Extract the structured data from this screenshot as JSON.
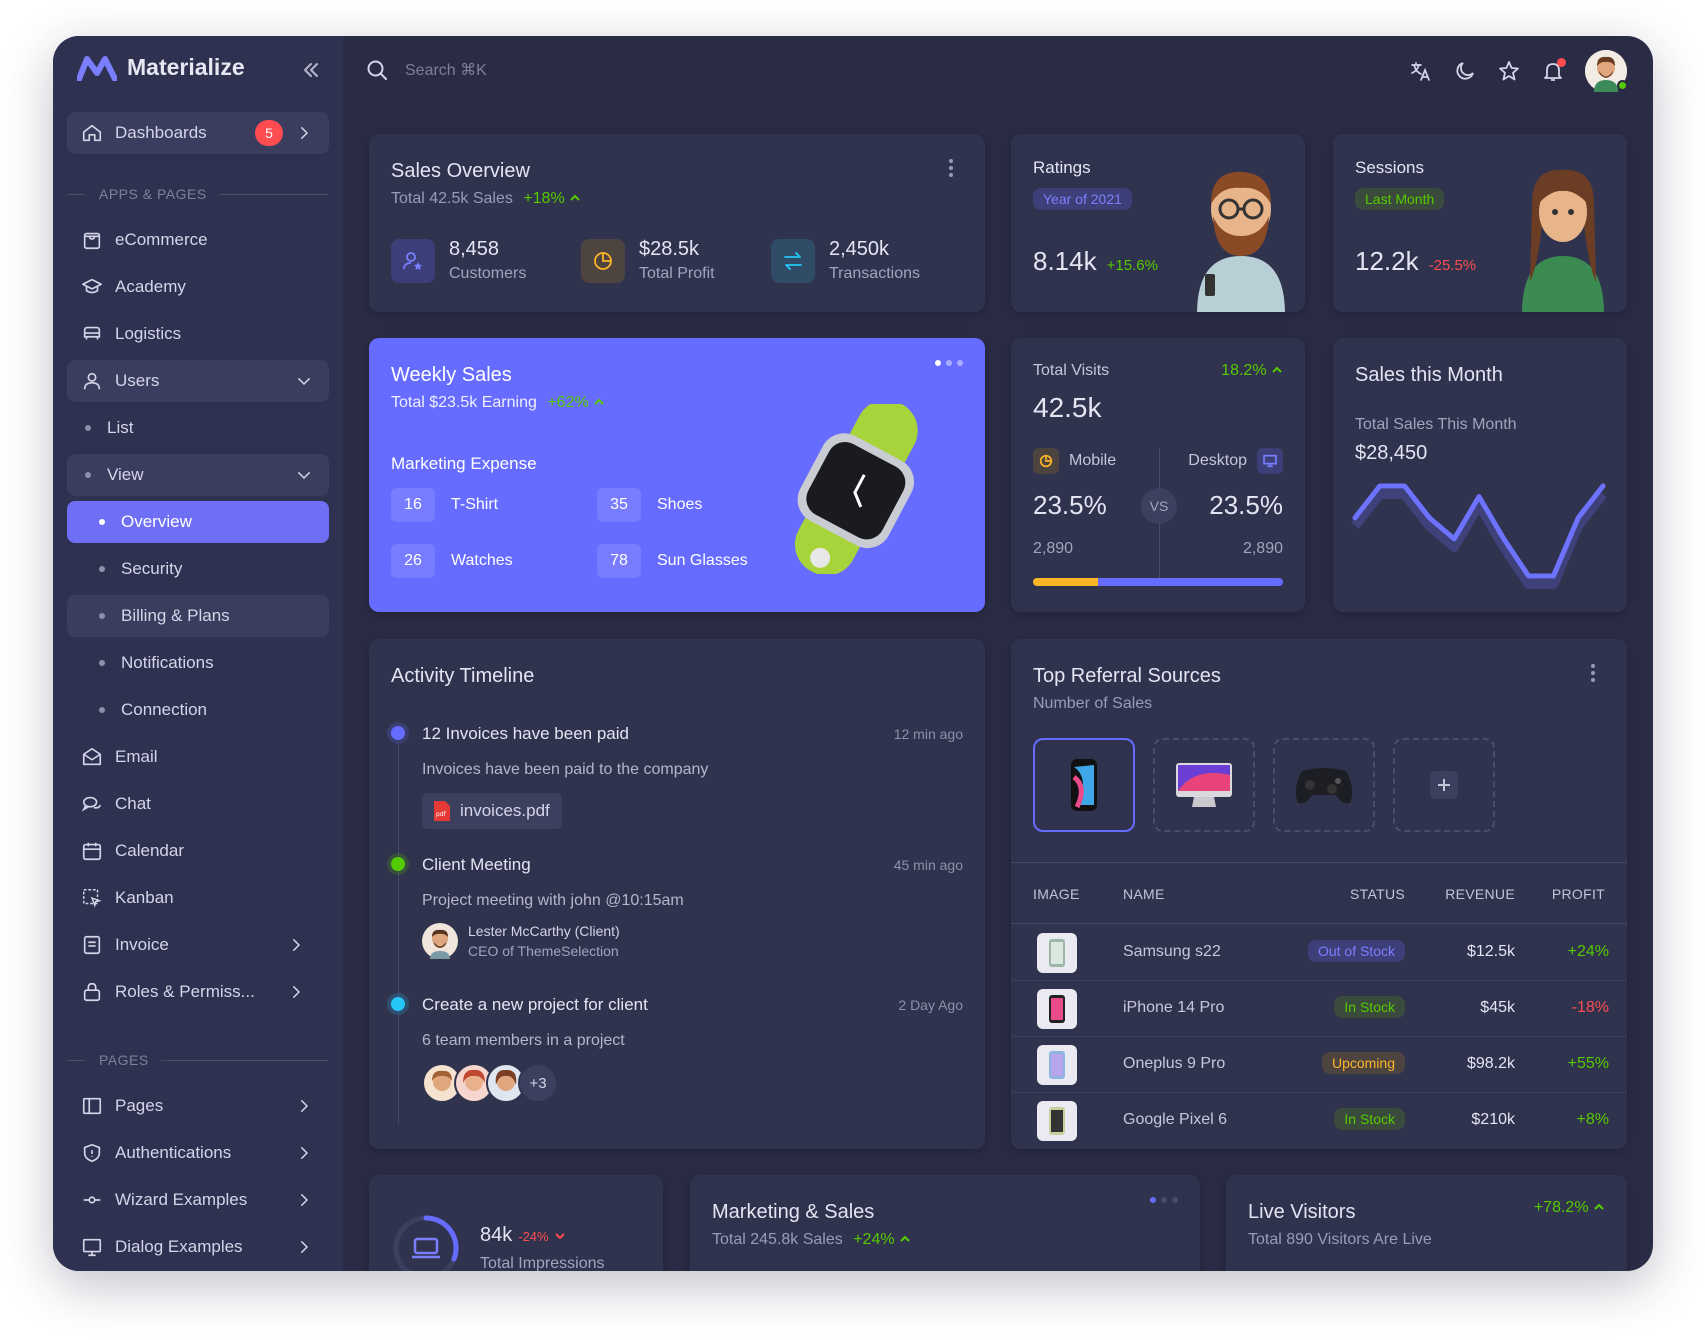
{
  "app": {
    "brand": "Materialize"
  },
  "sidebar": {
    "dashboards": {
      "label": "Dashboards",
      "badge": "5"
    },
    "section_apps": "APPS & PAGES",
    "items": [
      {
        "label": "eCommerce"
      },
      {
        "label": "Academy"
      },
      {
        "label": "Logistics"
      },
      {
        "label": "Users"
      },
      {
        "label": "List"
      },
      {
        "label": "View"
      },
      {
        "label": "Overview"
      },
      {
        "label": "Security"
      },
      {
        "label": "Billing & Plans"
      },
      {
        "label": "Notifications"
      },
      {
        "label": "Connection"
      },
      {
        "label": "Email"
      },
      {
        "label": "Chat"
      },
      {
        "label": "Calendar"
      },
      {
        "label": "Kanban"
      },
      {
        "label": "Invoice"
      },
      {
        "label": "Roles & Permiss..."
      }
    ],
    "section_pages": "PAGES",
    "pages": [
      {
        "label": "Pages"
      },
      {
        "label": "Authentications"
      },
      {
        "label": "Wizard Examples"
      },
      {
        "label": "Dialog Examples"
      }
    ]
  },
  "topbar": {
    "search_placeholder": "Search ⌘K"
  },
  "sales_overview": {
    "title": "Sales Overview",
    "subtitle": "Total 42.5k Sales",
    "change": "+18%",
    "stats": [
      {
        "value": "8,458",
        "label": "Customers"
      },
      {
        "value": "$28.5k",
        "label": "Total Profit"
      },
      {
        "value": "2,450k",
        "label": "Transactions"
      }
    ]
  },
  "ratings": {
    "title": "Ratings",
    "chip": "Year of 2021",
    "value": "8.14k",
    "change": "+15.6%"
  },
  "sessions": {
    "title": "Sessions",
    "chip": "Last Month",
    "value": "12.2k",
    "change": "-25.5%"
  },
  "weekly_sales": {
    "title": "Weekly Sales",
    "subtitle": "Total $23.5k Earning",
    "change": "+62%",
    "section": "Marketing Expense",
    "items": [
      {
        "num": "16",
        "label": "T-Shirt"
      },
      {
        "num": "35",
        "label": "Shoes"
      },
      {
        "num": "26",
        "label": "Watches"
      },
      {
        "num": "78",
        "label": "Sun Glasses"
      }
    ]
  },
  "total_visits": {
    "title": "Total Visits",
    "change": "18.2%",
    "value": "42.5k",
    "mobile_label": "Mobile",
    "desktop_label": "Desktop",
    "mobile_pct": "23.5%",
    "desktop_pct": "23.5%",
    "vs": "VS",
    "mobile_count": "2,890",
    "desktop_count": "2,890",
    "mobile_share": 0.26,
    "colors": {
      "mobile": "#fdb528",
      "desktop": "#666cff"
    }
  },
  "sales_month": {
    "title": "Sales this Month",
    "subtitle": "Total Sales This Month",
    "value": "$28,450",
    "trend": [
      28,
      40,
      40,
      28,
      20,
      36,
      20,
      6,
      6,
      28,
      40
    ]
  },
  "activity": {
    "title": "Activity Timeline",
    "events": [
      {
        "title": "12 Invoices have been paid",
        "time": "12 min ago",
        "desc": "Invoices have been paid to the company",
        "file": "invoices.pdf"
      },
      {
        "title": "Client Meeting",
        "time": "45 min ago",
        "desc": "Project meeting with john @10:15am",
        "person": "Lester McCarthy (Client)",
        "role": "CEO of ThemeSelection"
      },
      {
        "title": "Create a new project for client",
        "time": "2 Day Ago",
        "desc": "6 team members in a project",
        "more": "+3"
      }
    ],
    "dot_colors": [
      "#666cff",
      "#56ca00",
      "#26c6f9"
    ]
  },
  "referral": {
    "title": "Top Referral Sources",
    "subtitle": "Number of Sales",
    "headers": {
      "image": "IMAGE",
      "name": "NAME",
      "status": "STATUS",
      "revenue": "REVENUE",
      "profit": "PROFIT"
    },
    "rows": [
      {
        "name": "Samsung s22",
        "status": "Out of Stock",
        "revenue": "$12.5k",
        "profit": "+24%"
      },
      {
        "name": "iPhone 14 Pro",
        "status": "In Stock",
        "revenue": "$45k",
        "profit": "-18%"
      },
      {
        "name": "Oneplus 9 Pro",
        "status": "Upcoming",
        "revenue": "$98.2k",
        "profit": "+55%"
      },
      {
        "name": "Google Pixel 6",
        "status": "In Stock",
        "revenue": "$210k",
        "profit": "+8%"
      }
    ]
  },
  "impressions": {
    "value": "84k",
    "change": "-24%",
    "label": "Total Impressions"
  },
  "marketing": {
    "title": "Marketing & Sales",
    "subtitle": "Total 245.8k Sales",
    "change": "+24%"
  },
  "live": {
    "title": "Live Visitors",
    "subtitle": "Total 890 Visitors Are Live",
    "change": "+78.2%"
  }
}
